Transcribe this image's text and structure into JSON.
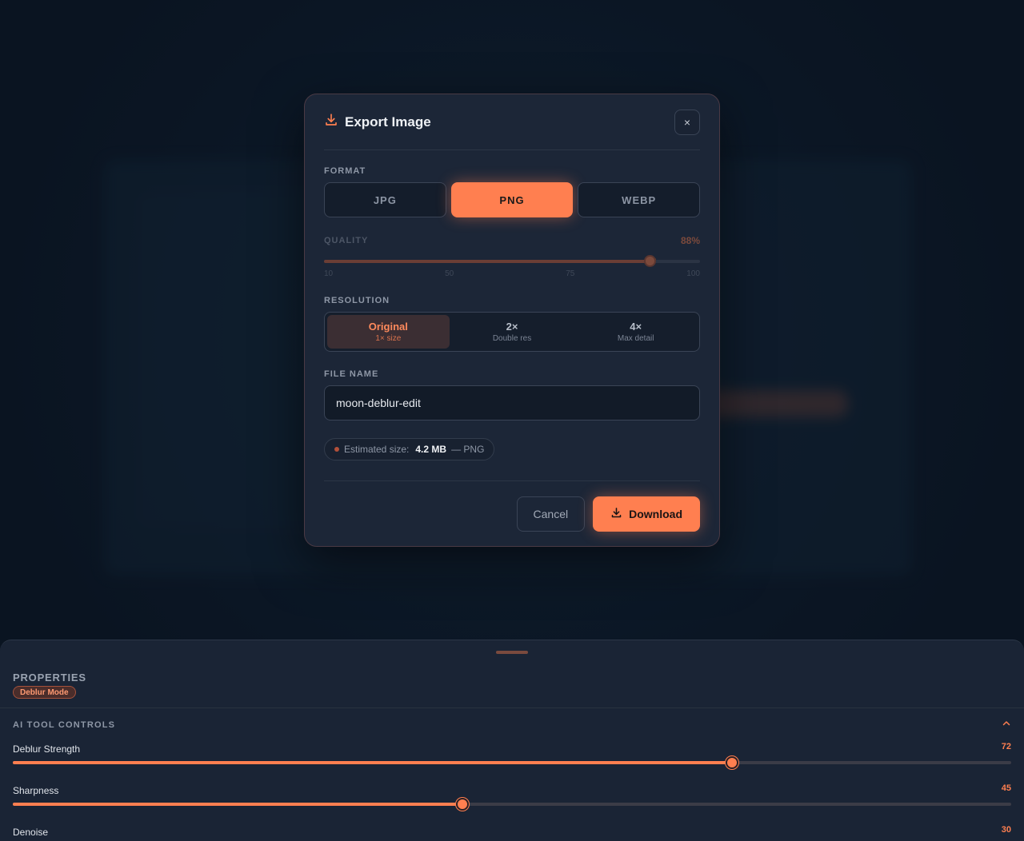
{
  "modal": {
    "title": "Export Image",
    "close_label": "×",
    "format": {
      "label": "FORMAT",
      "options": [
        "JPG",
        "PNG",
        "WEBP"
      ],
      "selected": "PNG"
    },
    "quality": {
      "label": "QUALITY",
      "value_text": "88%",
      "value": 88,
      "min": 10,
      "max": 100,
      "scale": [
        "10",
        "50",
        "75",
        "100"
      ]
    },
    "resolution": {
      "label": "RESOLUTION",
      "options": [
        {
          "title": "Original",
          "subtitle": "1× size"
        },
        {
          "title": "2×",
          "subtitle": "Double res"
        },
        {
          "title": "4×",
          "subtitle": "Max detail"
        }
      ],
      "selected_index": 0
    },
    "file_name": {
      "label": "FILE NAME",
      "value": "moon-deblur-edit"
    },
    "estimate": {
      "label": "Estimated size:",
      "size": "4.2 MB",
      "suffix": "— PNG"
    },
    "cancel_label": "Cancel",
    "download_label": "Download"
  },
  "sheet": {
    "title": "PROPERTIES",
    "mode_badge": "Deblur Mode",
    "section_title": "AI TOOL CONTROLS",
    "controls": [
      {
        "name": "Deblur Strength",
        "value": 72
      },
      {
        "name": "Sharpness",
        "value": 45
      },
      {
        "name": "Denoise",
        "value": 30
      }
    ]
  },
  "colors": {
    "accent": "#ff7f50",
    "background": "#0c1a28",
    "panel": "#1c2637"
  }
}
